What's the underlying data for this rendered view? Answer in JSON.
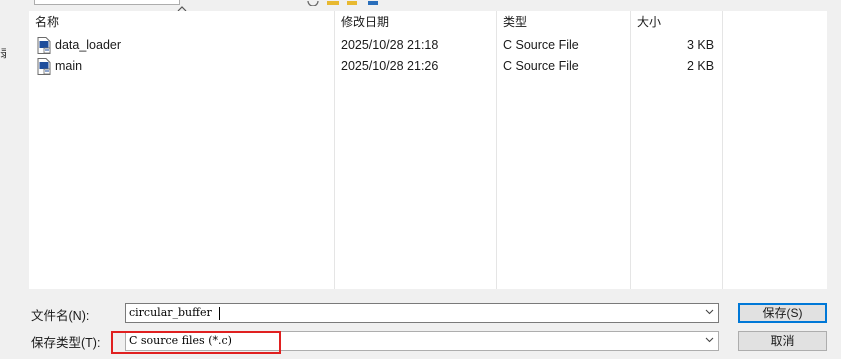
{
  "left_edge_glyph": "录",
  "columns": {
    "name": "名称",
    "modified": "修改日期",
    "type": "类型",
    "size": "大小"
  },
  "files": [
    {
      "name": "data_loader",
      "modified": "2025/10/28 21:18",
      "type": "C Source File",
      "size": "3 KB"
    },
    {
      "name": "main",
      "modified": "2025/10/28 21:26",
      "type": "C Source File",
      "size": "2 KB"
    }
  ],
  "filename": {
    "label": "文件名(N):",
    "value": "circular_buffer"
  },
  "filetype": {
    "label": "保存类型(T):",
    "value": "C source files (*.c)"
  },
  "buttons": {
    "save": "保存(S)",
    "cancel": "取消"
  },
  "icons": {
    "file": "c-source-file-icon",
    "dropdown": "chevron-down-icon",
    "sort": "sort-up-icon"
  }
}
